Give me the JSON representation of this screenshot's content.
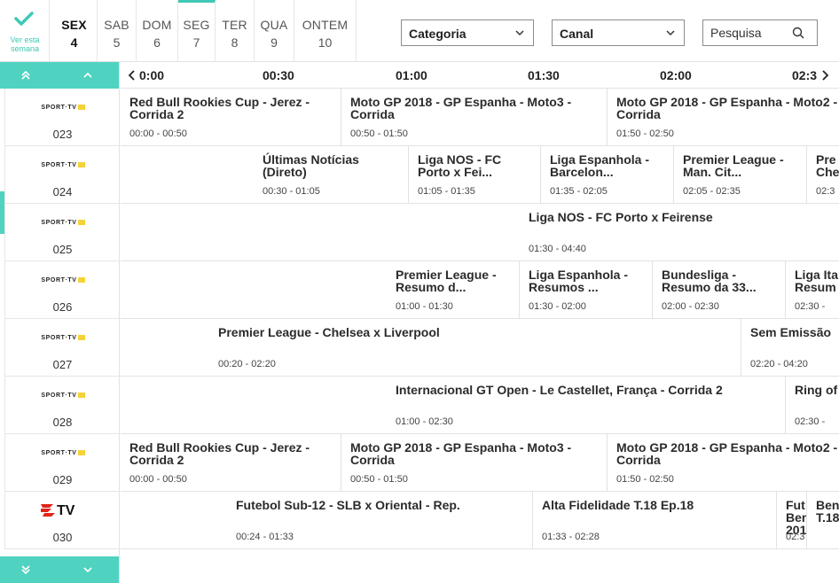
{
  "week_button": {
    "label": "Ver esta\nsemana"
  },
  "days": [
    {
      "name": "SEX",
      "num": "4",
      "today": true
    },
    {
      "name": "SAB",
      "num": "5"
    },
    {
      "name": "DOM",
      "num": "6"
    },
    {
      "name": "SEG",
      "num": "7",
      "selected": true
    },
    {
      "name": "TER",
      "num": "8"
    },
    {
      "name": "QUA",
      "num": "9"
    },
    {
      "name": "ONTEM",
      "num": "10"
    }
  ],
  "filters": {
    "category_label": "Categoria",
    "channel_label": "Canal",
    "search_placeholder": "Pesquisa"
  },
  "timeline": [
    "0:00",
    "00:30",
    "01:00",
    "01:30",
    "02:00",
    "02:3"
  ],
  "channels": [
    {
      "logo": "SPORT TV 5",
      "number": "023"
    },
    {
      "logo": "SPORT TV +",
      "number": "024"
    },
    {
      "logo": "SPORT TV 1",
      "number": "025"
    },
    {
      "logo": "SPORT TV 2",
      "number": "026"
    },
    {
      "logo": "SPORT TV 3",
      "number": "027"
    },
    {
      "logo": "SPORT TV 4",
      "number": "028"
    },
    {
      "logo": "SPORT TV 5",
      "number": "029"
    },
    {
      "logo": "BTV",
      "number": "030"
    }
  ],
  "programs": [
    [
      {
        "title": "Red Bull Rookies Cup - Jerez -\nCorrida 2",
        "time": "00:00 - 00:50"
      },
      {
        "title": "Moto GP 2018 - GP Espanha - Moto3 -\nCorrida",
        "time": "00:50 - 01:50"
      },
      {
        "title": "Moto GP 2018 - GP Espanha - Moto2 -\nCorrida",
        "time": "01:50 - 02:50"
      }
    ],
    [
      {
        "title": "Últimas Notícias\n(Direto)",
        "time": "00:30 - 01:05"
      },
      {
        "title": "Liga NOS - FC\nPorto x Fei...",
        "time": "01:05 - 01:35"
      },
      {
        "title": "Liga Espanhola -\nBarcelon...",
        "time": "01:35 - 02:05"
      },
      {
        "title": "Premier League -\nMan. Cit...",
        "time": "02:05 - 02:35"
      },
      {
        "title": "Pre\nChe",
        "time": "02:3"
      }
    ],
    [
      {
        "title": "Liga NOS - FC Porto x Feirense",
        "time": "01:30 - 04:40"
      }
    ],
    [
      {
        "title": "Premier League -\nResumo d...",
        "time": "01:00 - 01:30"
      },
      {
        "title": "Liga Espanhola -\nResumos ...",
        "time": "01:30 - 02:00"
      },
      {
        "title": "Bundesliga -\nResumo da 33...",
        "time": "02:00 - 02:30"
      },
      {
        "title": "Liga Ita\nResum",
        "time": "02:30 -"
      }
    ],
    [
      {
        "title": "Premier League - Chelsea x Liverpool",
        "time": "00:20 - 02:20"
      },
      {
        "title": "Sem Emissão",
        "time": "02:20 - 04:20"
      }
    ],
    [
      {
        "title": "Internacional GT Open - Le Castellet, França - Corrida 2",
        "time": "01:00 - 02:30"
      },
      {
        "title": "Ring of",
        "time": "02:30 -"
      }
    ],
    [
      {
        "title": "Red Bull Rookies Cup - Jerez -\nCorrida 2",
        "time": "00:00 - 00:50"
      },
      {
        "title": "Moto GP 2018 - GP Espanha - Moto3 -\nCorrida",
        "time": "00:50 - 01:50"
      },
      {
        "title": "Moto GP 2018 - GP Espanha - Moto2 -\nCorrida",
        "time": "01:50 - 02:50"
      }
    ],
    [
      {
        "title": "Futebol Sub-12 - SLB x Oriental - Rep.",
        "time": "00:24 - 01:33"
      },
      {
        "title": "Alta Fidelidade T.18 Ep.18",
        "time": "01:33 - 02:28"
      },
      {
        "title": "Fut\nBen\n201",
        "time": "02:3"
      },
      {
        "title": "Ben\nT.18",
        "time": ""
      }
    ]
  ],
  "colors": {
    "accent": "#4fd3c0",
    "logo_yellow": "#f6d23a",
    "btv_red": "#e2231a"
  }
}
